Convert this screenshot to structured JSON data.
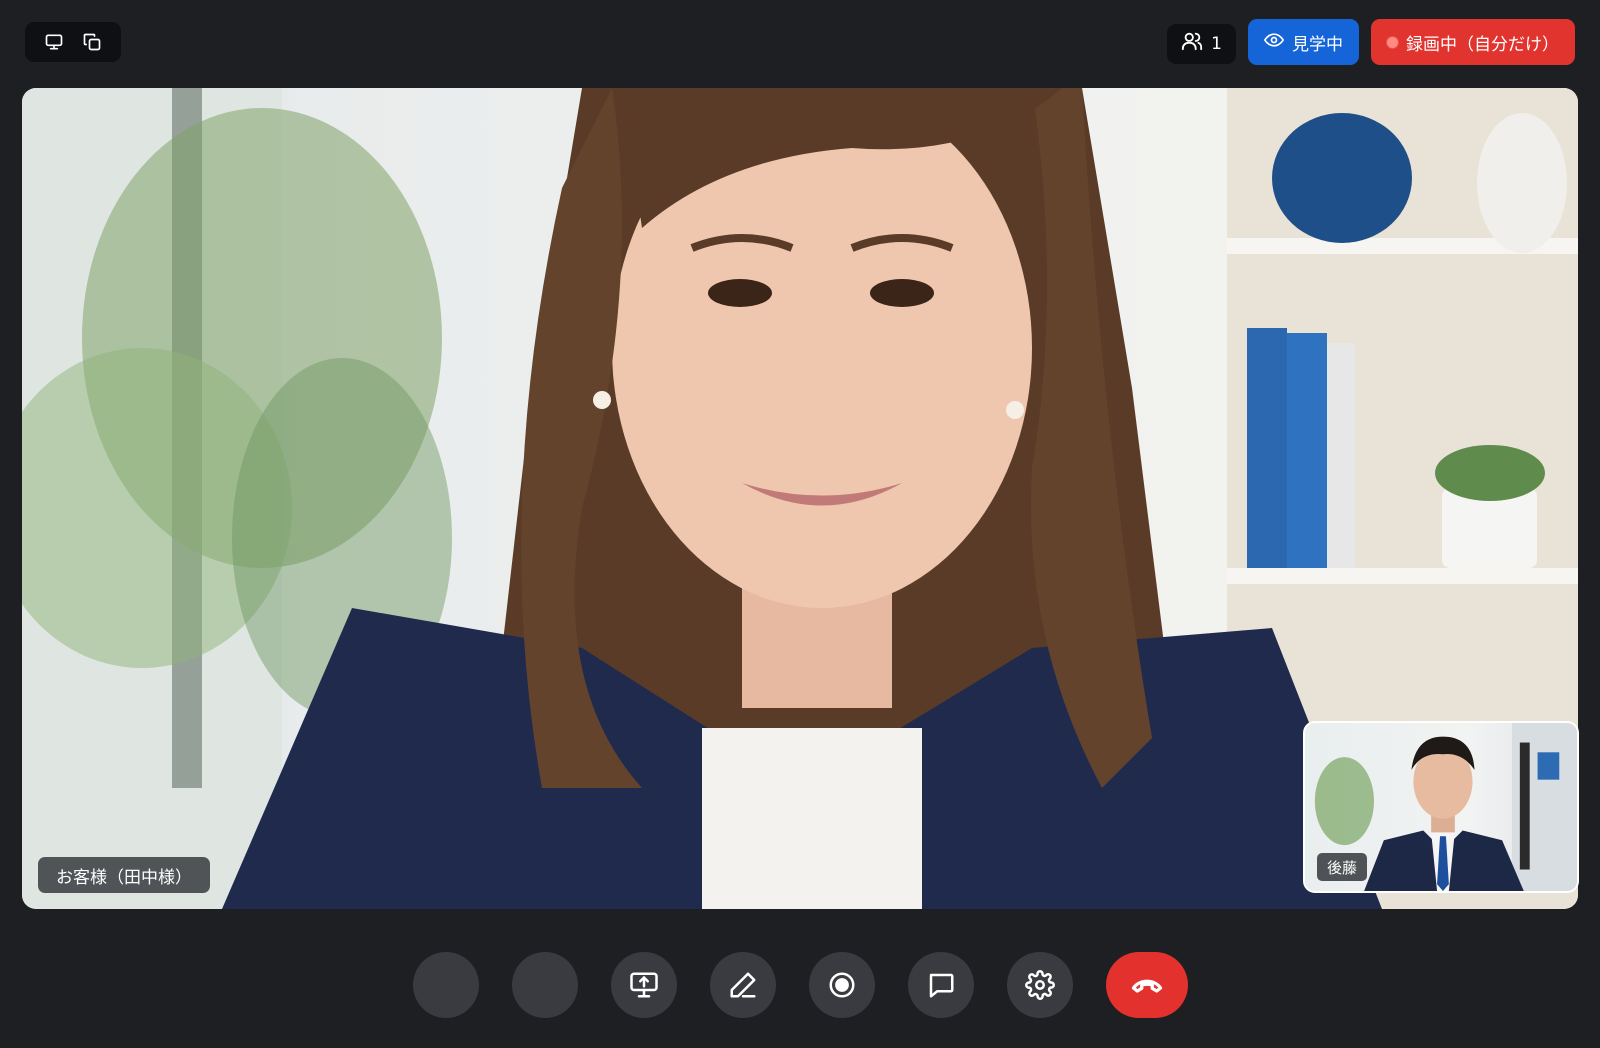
{
  "top_bar": {
    "view_buttons": [
      {
        "icon": "monitor-icon"
      },
      {
        "icon": "copy-windows-icon"
      }
    ],
    "participants": {
      "icon": "users-icon",
      "count": "1"
    },
    "observe": {
      "icon": "eye-icon",
      "label": "見学中",
      "color": "#1565d8"
    },
    "recording": {
      "label": "録画中（自分だけ）",
      "color": "#e2342e"
    }
  },
  "main_video": {
    "participant_name": "お客様（田中様）"
  },
  "self_view": {
    "participant_name": "後藤"
  },
  "controls": [
    {
      "name": "mic",
      "icon": "blank"
    },
    {
      "name": "camera",
      "icon": "blank"
    },
    {
      "name": "share-screen",
      "icon": "screen-share-icon"
    },
    {
      "name": "annotate",
      "icon": "pen-icon"
    },
    {
      "name": "record",
      "icon": "record-icon"
    },
    {
      "name": "chat",
      "icon": "chat-icon"
    },
    {
      "name": "settings",
      "icon": "gear-icon"
    },
    {
      "name": "end-call",
      "icon": "hang-up-icon",
      "color": "#e3322d"
    }
  ]
}
